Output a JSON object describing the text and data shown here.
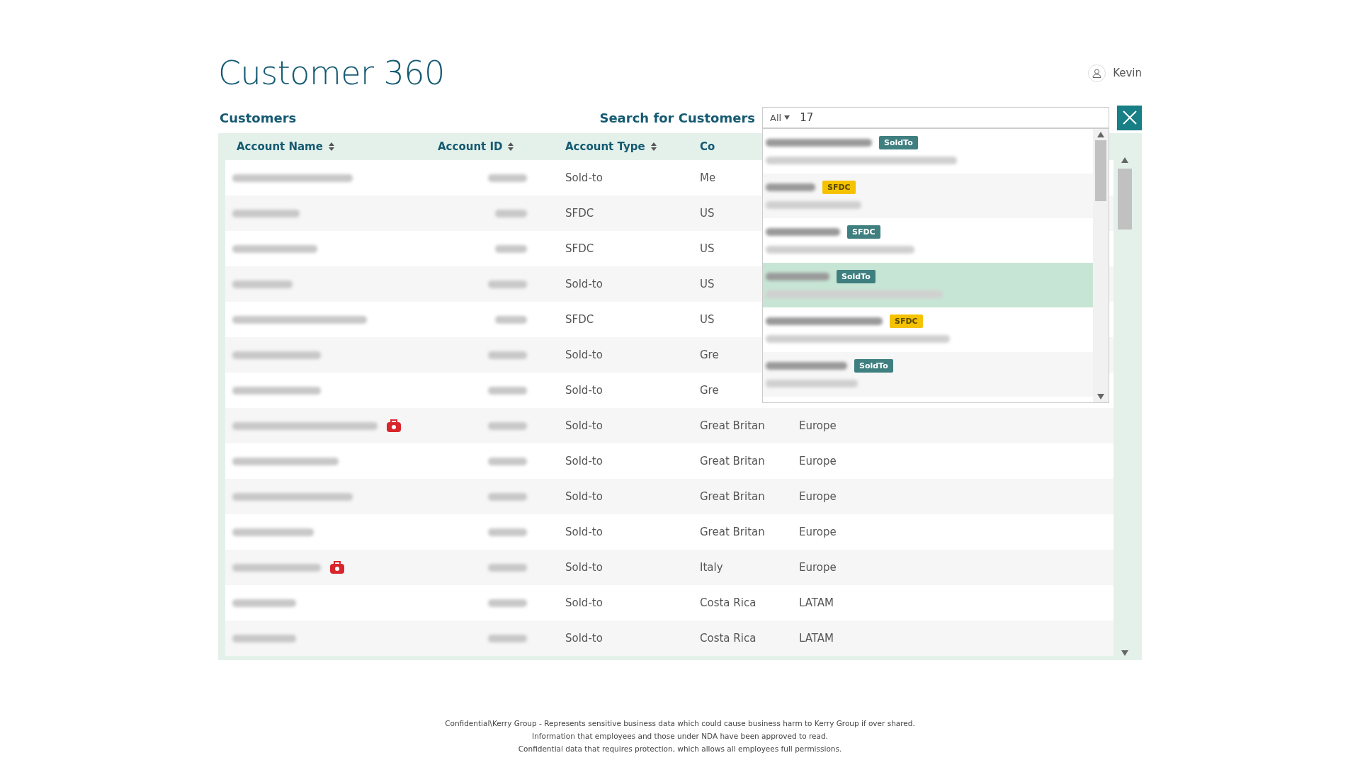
{
  "title": "Customer 360",
  "user": {
    "name": "Kevin"
  },
  "customers_heading": "Customers",
  "search": {
    "label": "Search for Customers",
    "scope": "All",
    "value": "17"
  },
  "table": {
    "columns": [
      {
        "label": "Account Name",
        "sortable": true
      },
      {
        "label": "Account ID",
        "sortable": true
      },
      {
        "label": "Account Type",
        "sortable": true
      },
      {
        "label": "Co",
        "sortable": false
      }
    ],
    "rows": [
      {
        "type": "Sold-to",
        "country": "Me",
        "flagged": false
      },
      {
        "type": "SFDC",
        "country": "US",
        "flagged": false
      },
      {
        "type": "SFDC",
        "country": "US",
        "flagged": false
      },
      {
        "type": "Sold-to",
        "country": "US",
        "flagged": false
      },
      {
        "type": "SFDC",
        "country": "US",
        "flagged": false
      },
      {
        "type": "Sold-to",
        "country": "Gre",
        "flagged": false
      },
      {
        "type": "Sold-to",
        "country": "Gre",
        "flagged": false
      },
      {
        "type": "Sold-to",
        "country": "Great Britan",
        "region": "Europe",
        "flagged": true
      },
      {
        "type": "Sold-to",
        "country": "Great Britan",
        "region": "Europe",
        "flagged": false
      },
      {
        "type": "Sold-to",
        "country": "Great Britan",
        "region": "Europe",
        "flagged": false
      },
      {
        "type": "Sold-to",
        "country": "Great Britan",
        "region": "Europe",
        "flagged": false
      },
      {
        "type": "Sold-to",
        "country": "Italy",
        "region": "Europe",
        "flagged": true
      },
      {
        "type": "Sold-to",
        "country": "Costa Rica",
        "region": "LATAM",
        "flagged": false
      },
      {
        "type": "Sold-to",
        "country": "Costa Rica",
        "region": "LATAM",
        "flagged": false
      }
    ]
  },
  "results": [
    {
      "selected": false,
      "tag": {
        "label": "SoldTo",
        "color": "#3f7f80"
      }
    },
    {
      "selected": false,
      "tag": {
        "label": "SFDC",
        "color": "#f5c200"
      }
    },
    {
      "selected": false,
      "tag": {
        "label": "SFDC",
        "color": "#3f7f80"
      }
    },
    {
      "selected": true,
      "tag": {
        "label": "SoldTo",
        "color": "#3f7f80"
      }
    },
    {
      "selected": false,
      "tag": {
        "label": "SFDC",
        "color": "#f5c200"
      }
    },
    {
      "selected": false,
      "tag": {
        "label": "SoldTo",
        "color": "#3f7f80"
      }
    }
  ],
  "footer": [
    "Confidential\\Kerry Group - Represents sensitive business data which could cause business harm to Kerry Group if over shared.",
    "Information that employees and those under NDA have been approved to read.",
    "Confidential data that requires protection, which allows all employees full permissions."
  ]
}
